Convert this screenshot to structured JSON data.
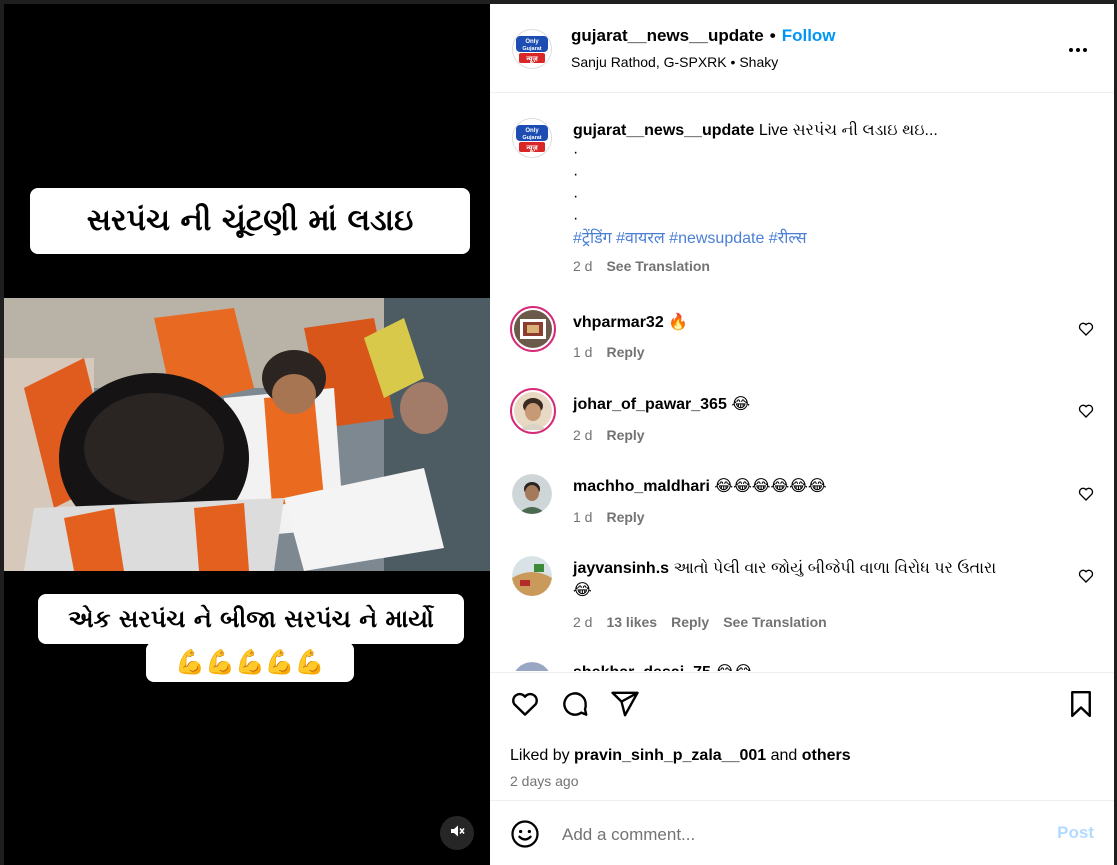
{
  "media": {
    "caption_top": "સરપંચ ની ચૂંટણી માં લડાઇ",
    "caption_bottom_line1": "એક સરપંચ ને બીજા સરપંચ ને માર્યો",
    "caption_bottom_line2": "💪💪💪💪💪",
    "mute_icon": "speaker-muted-icon"
  },
  "header": {
    "username": "gujarat__news__update",
    "follow_label": "Follow",
    "audio_line": "Sanju Rathod, G-SPXRK • Shaky",
    "logo_text_1": "Only",
    "logo_text_2": "Gujarat",
    "logo_text_3": "न्यूज़"
  },
  "caption": {
    "username": "gujarat__news__update",
    "text": " Live સરપંચ ની લડાઇ થઇ...",
    "dots": [
      "·",
      "·",
      "·",
      "·"
    ],
    "hashtags": "#ट्रेंडिंग #वायरल #newsupdate #रील्स",
    "time": "2 d",
    "see_translation": "See Translation"
  },
  "comments": [
    {
      "username": "vhparmar32",
      "text": "🔥",
      "time": "1 d",
      "reply": "Reply"
    },
    {
      "username": "johar_of_pawar_365",
      "text": "😂",
      "time": "2 d",
      "reply": "Reply"
    },
    {
      "username": "machho_maldhari",
      "text": "😂😂😂😂😂😂",
      "time": "1 d",
      "reply": "Reply"
    },
    {
      "username": "jayvansinh.s",
      "text": "આતો પેલી વાર જોયું બીજેપી વાળા વિરોધ પર ઉતારા",
      "text2": "😂",
      "time": "2 d",
      "likes": "13 likes",
      "reply": "Reply",
      "see_translation": "See Translation"
    },
    {
      "username": "shekhar_desai_75",
      "text": "😂😂"
    }
  ],
  "actions": {
    "liked_prefix": "Liked by ",
    "liked_user": "pravin_sinh_p_zala__001",
    "liked_and": " and ",
    "liked_others": "others",
    "time_ago": "2 days ago"
  },
  "composer": {
    "placeholder": "Add a comment...",
    "post_label": "Post"
  },
  "colors": {
    "accent": "#0095f6",
    "muted_text": "#737373",
    "hashtag": "#4b7fd6",
    "post_disabled": "#b3dbff"
  }
}
